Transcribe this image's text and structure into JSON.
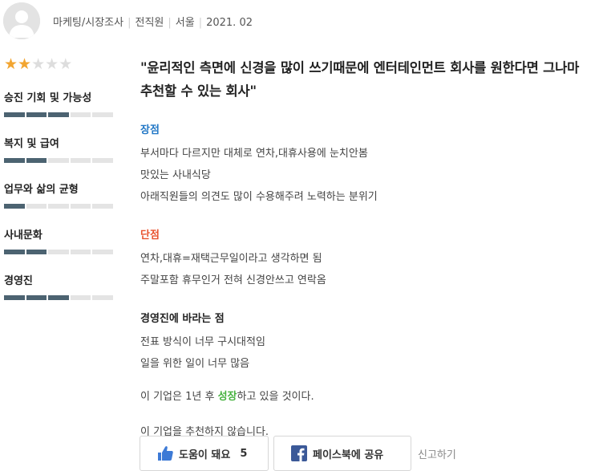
{
  "author": {
    "job": "마케팅/시장조사",
    "status": "전직원",
    "location": "서울",
    "date": "2021. 02"
  },
  "rating": {
    "stars": 2,
    "max_stars": 5,
    "star_color": "#f2a531"
  },
  "categories": [
    {
      "label": "승진 기회 및 가능성",
      "score": 3,
      "max": 5
    },
    {
      "label": "복지 및 급여",
      "score": 2,
      "max": 5
    },
    {
      "label": "업무와 삶의 균형",
      "score": 1,
      "max": 5
    },
    {
      "label": "사내문화",
      "score": 2,
      "max": 5
    },
    {
      "label": "경영진",
      "score": 3,
      "max": 5
    }
  ],
  "review": {
    "headline_line1": "\"윤리적인 측면에 신경을 많이 쓰기때문에 엔터테인먼트 회사를 원한다면 그나마",
    "headline_line2": "추천할 수 있는 회사\"",
    "pros_title": "장점",
    "pros_lines": [
      "부서마다 다르지만 대체로 연차,대휴사용에 눈치안봄",
      "맛있는 사내식당",
      "아래직원들의 의견도 많이 수용해주려 노력하는 분위기"
    ],
    "cons_title": "단점",
    "cons_lines": [
      "연차,대휴=재택근무일이라고 생각하면 됨",
      "주말포함 휴무인거 전혀 신경안쓰고 연락옴"
    ],
    "wish_title": "경영진에 바라는 점",
    "wish_lines": [
      "전표 방식이 너무 구시대적임",
      "일을 위한 일이 너무 많음"
    ],
    "growth_prefix": "이 기업은 1년 후 ",
    "growth_highlight": "성장",
    "growth_suffix": "하고 있을 것이다.",
    "recommend": "이 기업을 추천하지 않습니다."
  },
  "actions": {
    "helpful_label": "도움이 돼요",
    "helpful_count": "5",
    "facebook_label": "페이스북에 공유",
    "report_label": "신고하기"
  },
  "colors": {
    "pros": "#2378c6",
    "cons": "#e8532f",
    "growth": "#46b13f",
    "bar_fill": "#4c6371",
    "bar_empty": "#e4e4e4",
    "facebook": "#3b5998",
    "like": "#3d7ad6"
  },
  "icons": {
    "avatar": "user-silhouette-icon",
    "helpful": "thumbs-up-icon",
    "facebook": "facebook-icon"
  }
}
